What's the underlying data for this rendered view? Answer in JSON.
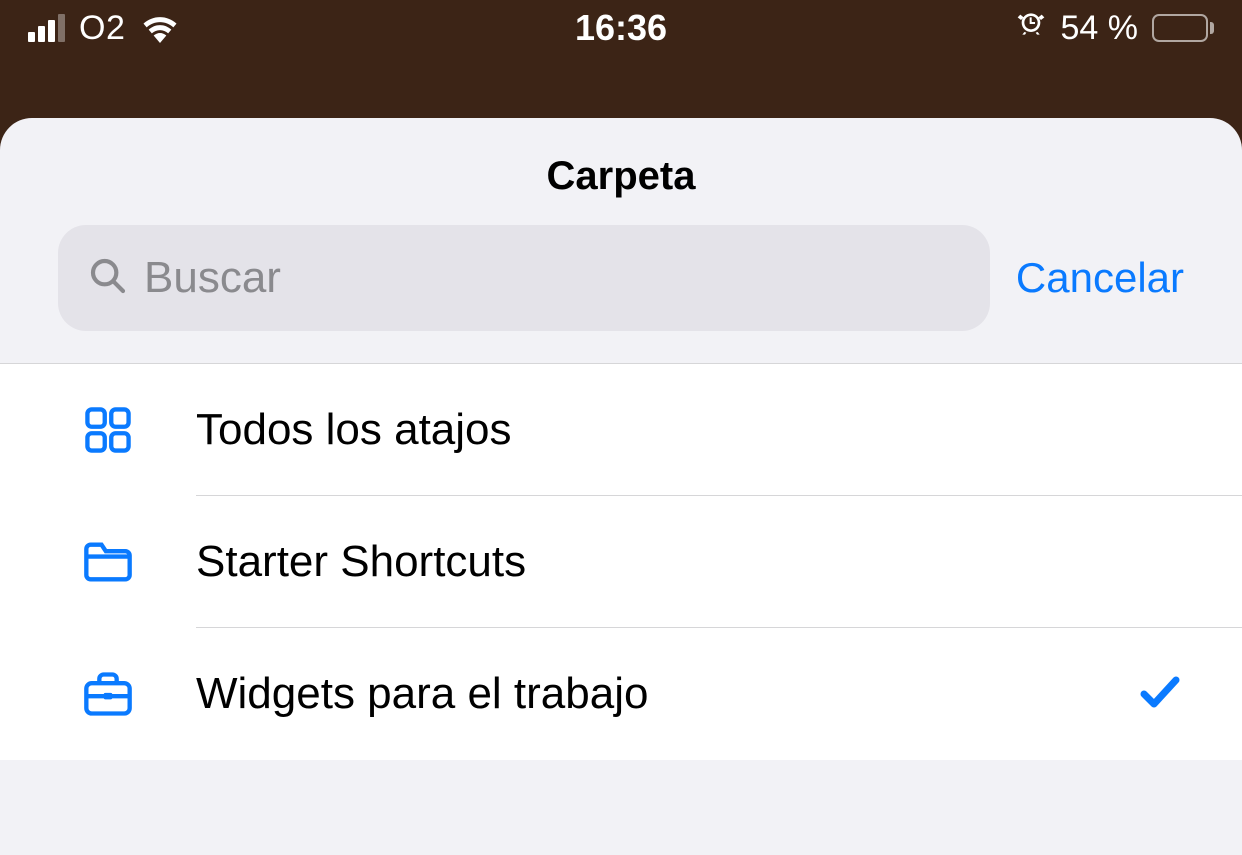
{
  "status_bar": {
    "carrier": "O2",
    "time": "16:36",
    "battery_percent": "54 %"
  },
  "sheet": {
    "title": "Carpeta",
    "search_placeholder": "Buscar",
    "cancel_label": "Cancelar",
    "items": [
      {
        "icon": "grid",
        "label": "Todos los atajos",
        "selected": false
      },
      {
        "icon": "folder",
        "label": "Starter Shortcuts",
        "selected": false
      },
      {
        "icon": "briefcase",
        "label": "Widgets para el trabajo",
        "selected": true
      }
    ]
  },
  "colors": {
    "accent": "#0a7aff"
  }
}
